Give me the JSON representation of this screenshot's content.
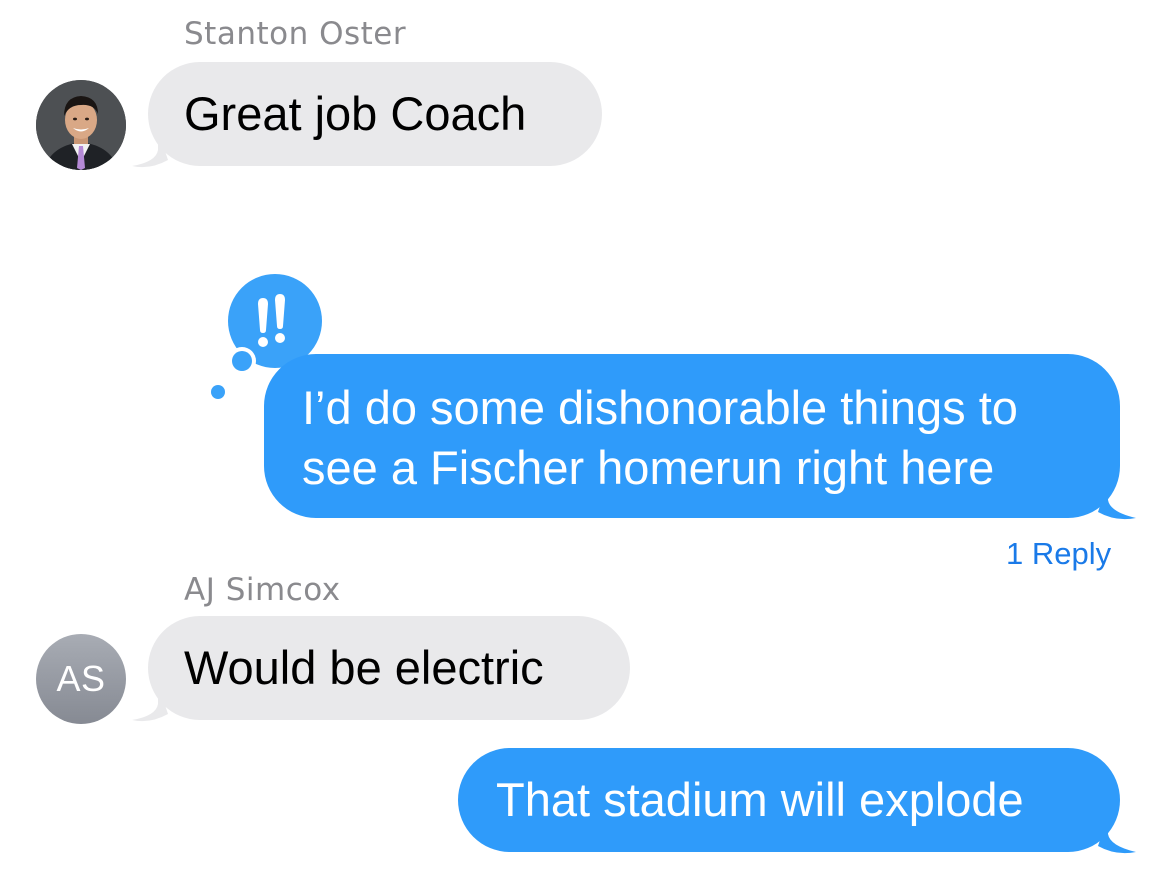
{
  "colors": {
    "incoming_bubble": "#e9e9eb",
    "outgoing_bubble": "#2f9bfa",
    "sender_name": "#8a8a8e",
    "reply_link": "#1a7ae8"
  },
  "messages": [
    {
      "sender": "Stanton Oster",
      "avatar": "person-photo",
      "text": "Great job Coach",
      "direction": "incoming"
    },
    {
      "direction": "outgoing",
      "lines": [
        "I’d do some dishonorable things to",
        "see a Fischer homerun right here"
      ],
      "tapback": "exclamation-icon",
      "reply_link": "1 Reply"
    },
    {
      "sender": "AJ Simcox",
      "avatar_initials": "AS",
      "text": "Would be electric",
      "direction": "incoming"
    },
    {
      "direction": "outgoing",
      "text": "That stadium will explode"
    }
  ]
}
